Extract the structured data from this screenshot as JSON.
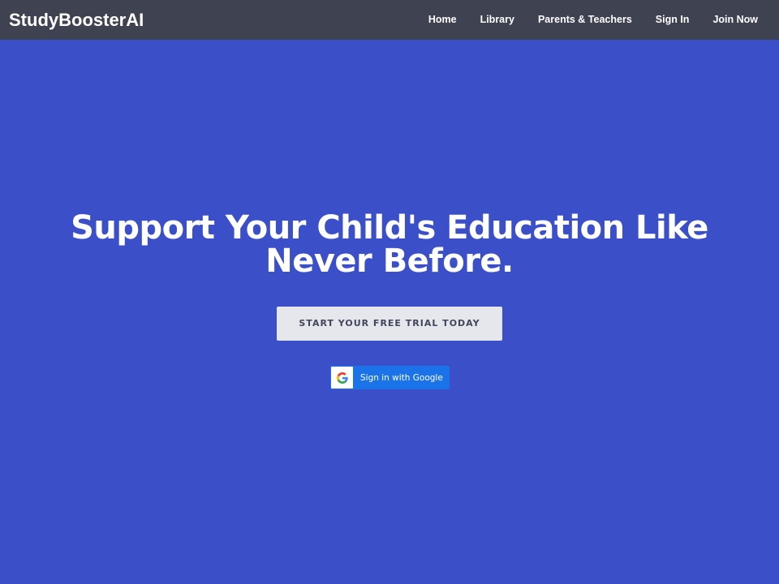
{
  "header": {
    "brand": "StudyBoosterAI",
    "nav": [
      {
        "label": "Home"
      },
      {
        "label": "Library"
      },
      {
        "label": "Parents & Teachers"
      },
      {
        "label": "Sign In"
      },
      {
        "label": "Join Now"
      }
    ]
  },
  "hero": {
    "title_line1": "Support Your Child's Education Like",
    "title_line2": "Never Before.",
    "cta_label": "START YOUR FREE TRIAL TODAY",
    "google_label": "Sign in with Google",
    "google_icon": "google-g-icon"
  },
  "colors": {
    "hero_bg": "#3b4fc8",
    "navbar_bg": "#3e4251",
    "cta_bg": "#e6e7ed",
    "google_blue": "#1a73e8"
  }
}
